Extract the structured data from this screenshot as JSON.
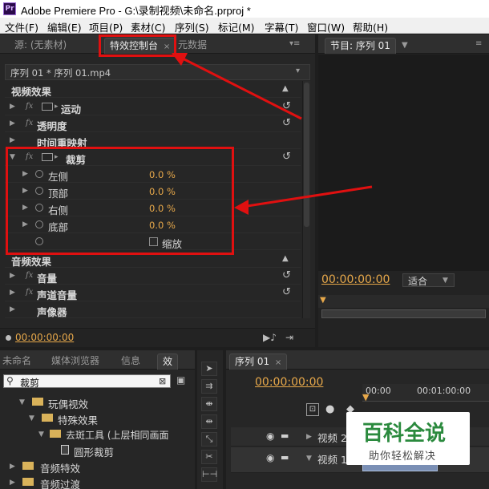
{
  "window": {
    "title": "Adobe Premiere Pro - G:\\录制视频\\未命名.prproj *",
    "logo": "Pr"
  },
  "menu": [
    "文件(F)",
    "编辑(E)",
    "项目(P)",
    "素材(C)",
    "序列(S)",
    "标记(M)",
    "字幕(T)",
    "窗口(W)",
    "帮助(H)"
  ],
  "top_left_panel": {
    "tabs": [
      "源: (无素材)",
      "特效控制台",
      "元数据"
    ],
    "active_tab": "特效控制台",
    "close_glyph": "×",
    "header": "序列 01 * 序列 01.mp4",
    "video_section": "视频效果",
    "audio_section": "音频效果",
    "fx_glyph": "fx",
    "video_effects": [
      "运动",
      "透明度",
      "时间重映射"
    ],
    "crop": {
      "name": "裁剪",
      "params": [
        {
          "label": "左侧",
          "value": "0.0 %"
        },
        {
          "label": "顶部",
          "value": "0.0 %"
        },
        {
          "label": "右侧",
          "value": "0.0 %"
        },
        {
          "label": "底部",
          "value": "0.0 %"
        }
      ],
      "checkbox_label": "缩放"
    },
    "audio_effects": [
      "音量",
      "声道音量",
      "声像器"
    ],
    "timecode": "00:00:00:00"
  },
  "program_monitor": {
    "tab": "节目: 序列 01",
    "timecode": "00:00:00:00",
    "fit_label": "适合"
  },
  "project_panel": {
    "tabs": [
      "未命名",
      "媒体浏览器",
      "信息",
      "效"
    ],
    "search_value": "裁剪",
    "tree": [
      {
        "label": "玩偶视效",
        "level": 1,
        "open": true
      },
      {
        "label": "特殊效果",
        "level": 2,
        "open": true
      },
      {
        "label": "去斑工具 (上层相同画面",
        "level": 3,
        "open": true
      },
      {
        "label": "圆形裁剪",
        "level": 4,
        "open": false
      },
      {
        "label": "音频特效",
        "level": 1,
        "open": false
      },
      {
        "label": "音频过渡",
        "level": 1,
        "open": false
      }
    ]
  },
  "timeline": {
    "tab": "序列 01",
    "timecode": "00:00:00:00",
    "ruler": [
      "00:00",
      "00:01:00:00"
    ],
    "tracks": [
      "视频 2",
      "视频 1"
    ]
  },
  "watermark": {
    "title": "百科全说",
    "subtitle": "助你轻松解决"
  },
  "colors": {
    "timecode": "#e7a84a",
    "highlight": "#e01010",
    "panel_bg": "#262626"
  }
}
